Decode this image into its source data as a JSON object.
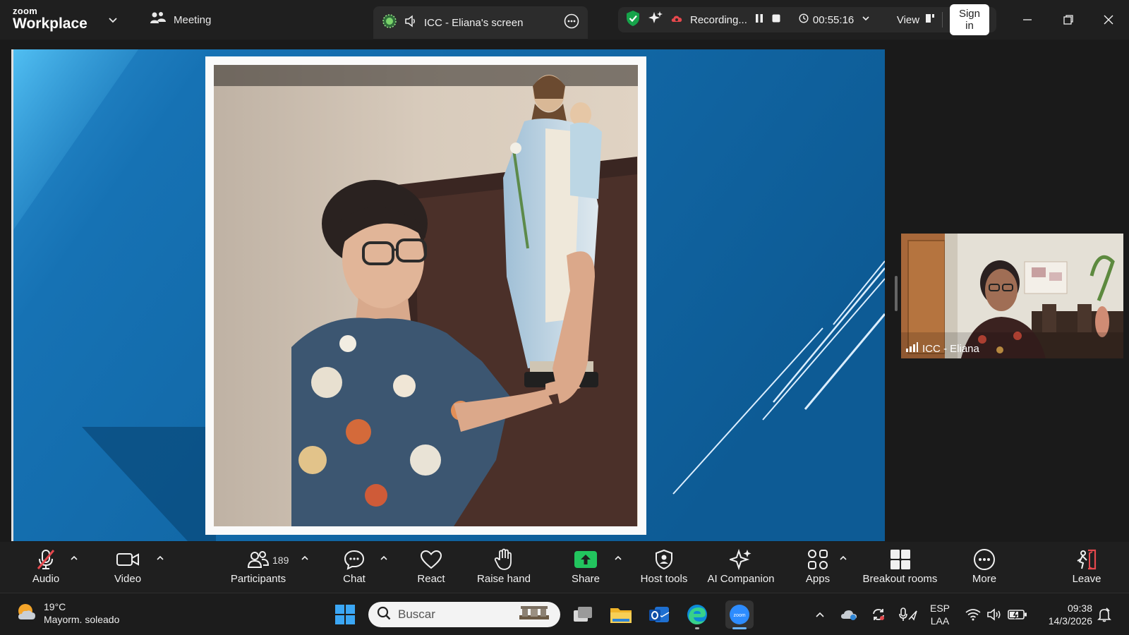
{
  "app": {
    "brand_small": "zoom",
    "brand_large": "Workplace",
    "meeting_tab": "Meeting",
    "screen_share_label": "ICC - Eliana's screen"
  },
  "recording": {
    "status": "Recording...",
    "timer": "00:55:16",
    "view_label": "View",
    "sign_in": "Sign in"
  },
  "self_view": {
    "name": "ICC - Eliana"
  },
  "toolbar": {
    "audio": "Audio",
    "video": "Video",
    "participants": "Participants",
    "participants_count": "189",
    "chat": "Chat",
    "react": "React",
    "raise_hand": "Raise hand",
    "share": "Share",
    "host_tools": "Host tools",
    "ai_companion": "AI Companion",
    "apps": "Apps",
    "breakout_rooms": "Breakout rooms",
    "more": "More",
    "leave": "Leave"
  },
  "taskbar": {
    "weather_temp": "19°C",
    "weather_desc": "Mayorm. soleado",
    "search_placeholder": "Buscar",
    "lang_line1": "ESP",
    "lang_line2": "LAA",
    "time": "09:38",
    "date": "14/3/2026"
  },
  "colors": {
    "share_green": "#22c55e",
    "shield_green": "#16a34a",
    "recording_red": "#e5484d",
    "leave_red": "#e5484d",
    "slide_blue": "#0f5a93"
  }
}
